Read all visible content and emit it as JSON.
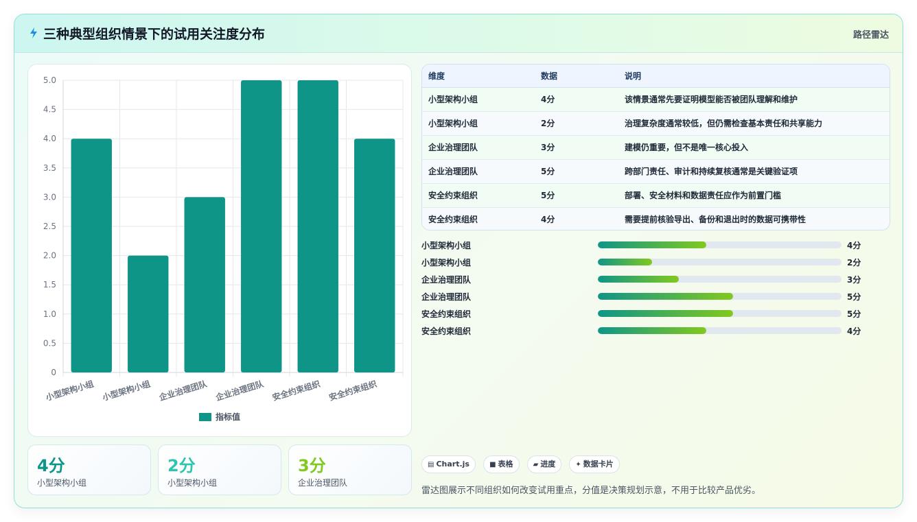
{
  "header": {
    "icon": "lightning-icon",
    "title": "三种典型组织情景下的试用关注度分布",
    "right_label": "路径雷达"
  },
  "chart_data": {
    "type": "bar",
    "categories": [
      "小型架构小组",
      "小型架构小组",
      "企业治理团队",
      "企业治理团队",
      "安全约束组织",
      "安全约束组织"
    ],
    "series": [
      {
        "name": "指标值",
        "values": [
          4,
          2,
          3,
          5,
          5,
          4
        ],
        "color": "#0f9588"
      }
    ],
    "ylim": [
      0,
      5
    ],
    "yticks": [
      "0",
      "0.5",
      "1.0",
      "1.5",
      "2.0",
      "2.5",
      "3.0",
      "3.5",
      "4.0",
      "4.5",
      "5.0"
    ],
    "grid": true,
    "legend": "bottom"
  },
  "table": {
    "headers": [
      "维度",
      "数据",
      "说明"
    ],
    "rows": [
      [
        "小型架构小组",
        "4分",
        "该情景通常先要证明模型能否被团队理解和维护"
      ],
      [
        "小型架构小组",
        "2分",
        "治理复杂度通常较低，但仍需检查基本责任和共享能力"
      ],
      [
        "企业治理团队",
        "3分",
        "建模仍重要，但不是唯一核心投入"
      ],
      [
        "企业治理团队",
        "5分",
        "跨部门责任、审计和持续复核通常是关键验证项"
      ],
      [
        "安全约束组织",
        "5分",
        "部署、安全材料和数据责任应作为前置门槛"
      ],
      [
        "安全约束组织",
        "4分",
        "需要提前核验导出、备份和退出时的数据可携带性"
      ]
    ]
  },
  "progress": [
    {
      "label": "小型架构小组",
      "value": 4,
      "value_label": "4分"
    },
    {
      "label": "小型架构小组",
      "value": 2,
      "value_label": "2分"
    },
    {
      "label": "企业治理团队",
      "value": 3,
      "value_label": "3分"
    },
    {
      "label": "企业治理团队",
      "value": 5,
      "value_label": "5分"
    },
    {
      "label": "安全约束组织",
      "value": 5,
      "value_label": "5分"
    },
    {
      "label": "安全约束组织",
      "value": 4,
      "value_label": "4分"
    }
  ],
  "progress_max": 9,
  "stats": [
    {
      "value": "4分",
      "label": "小型架构小组",
      "color": "#0f9588"
    },
    {
      "value": "2分",
      "label": "小型架构小组",
      "color": "#2ec4b0"
    },
    {
      "value": "3分",
      "label": "企业治理团队",
      "color": "#82c91e"
    }
  ],
  "tags": [
    {
      "icon": "chart-icon",
      "glyph": "▤",
      "label": "Chart.js"
    },
    {
      "icon": "table-icon",
      "glyph": "■",
      "label": "表格"
    },
    {
      "icon": "progress-icon",
      "glyph": "▰",
      "label": "进度"
    },
    {
      "icon": "sparkle-icon",
      "glyph": "✦",
      "label": "数据卡片"
    }
  ],
  "footnote": "雷达图展示不同组织如何改变试用重点，分值是决策规划示意，不用于比较产品优劣。"
}
